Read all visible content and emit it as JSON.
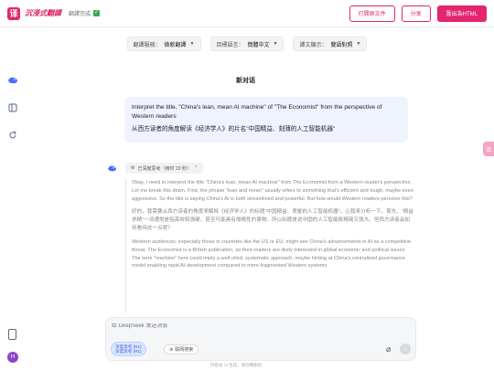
{
  "app": {
    "logo_glyph": "译",
    "title": "沉浸式翻譯",
    "status": "翻譯完成",
    "accent": "#e4256f"
  },
  "toolbar": {
    "print_label": "打開原文件",
    "share_label": "分享",
    "export_label": "匯出為HTML"
  },
  "settings": {
    "service_label": "翻譯服務：",
    "service_value": "微軟翻譯",
    "target_label": "目標語言：",
    "target_value": "簡體中文",
    "display_label": "譯文顯示：",
    "display_value": "雙語對照"
  },
  "conversation": {
    "title": "新对话",
    "user_message_en": "Interpret the title, \"China's lean, mean AI machine\" of \"The Economist\" from the perspective of Western readers",
    "user_message_zh": "从西方读者的角度解读《经济学人》的片名\"中国精益、刻薄的人工智能机器\"",
    "think_badge": "已深度思考（用时 23 秒）",
    "thinking": [
      "Okay, I need to interpret the title \"China's lean, mean AI machine\" from The Economist from a Western reader's perspective. Let me break this down. First, the phrase \"lean and mean\" usually refers to something that's efficient and tough, maybe even aggressive. So the title is saying China's AI is both streamlined and powerful. But how would Western readers perceive this?",
      "好的，我需要从西方读者的角度来解释《经济学人》的标题\"中国精益、卑鄙的人工智能机器\"。让我来分析一下。首先，\"精益求精\"一词通常是指高效和强硬，甚至可能具有侵略性的事物。所以标题是说中国的人工智能既精简又强大。但西方读者会如何看待这一点呢？",
      "Western audiences, especially those in countries like the US or EU, might see China's advancements in AI as a competitive threat. The Economist is a British publication, so their readers are likely interested in global economic and political issues. The term \"machine\" here could imply a well-oiled, systematic approach, maybe hinting at China's centralized governance model enabling rapid AI development compared to more fragmented Western systems."
    ]
  },
  "composer": {
    "placeholder": "给 DeepSeek 发送消息",
    "chip_deep_line1": "深度思考 (R1)",
    "chip_deep_line2": "深度思考 (R1)",
    "chip_search": "联网搜索",
    "footer": "内容由 AI 生成，请仔细甄别"
  },
  "icons": {
    "ai_logo": "whale-icon",
    "attach": "paperclip-icon",
    "send": "send-arrow-icon"
  }
}
